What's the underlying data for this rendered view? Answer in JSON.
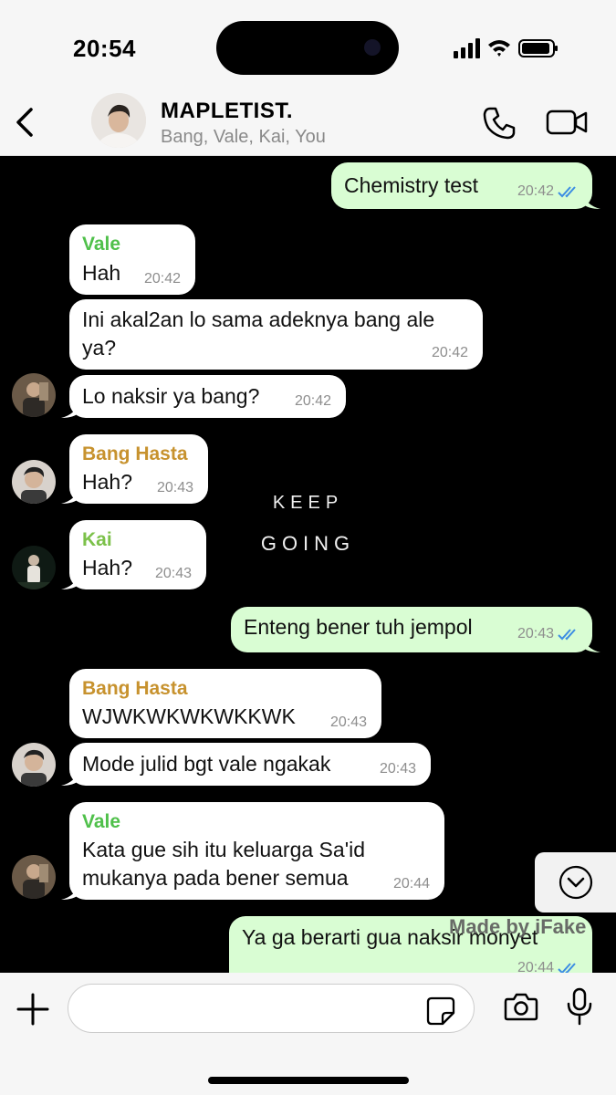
{
  "status": {
    "time": "20:54"
  },
  "header": {
    "title": "MAPLETIST.",
    "members": "Bang, Vale, Kai, You"
  },
  "wallpaper": {
    "line1": "KEEP",
    "line2": "GOING"
  },
  "colors": {
    "outgoing": "#d9fdd3",
    "incoming": "#ffffff",
    "vale": "#4fc04a",
    "bang_hasta": "#c7922e",
    "kai": "#7cc14a",
    "read_tick": "#3c8de3"
  },
  "messages": [
    {
      "dir": "out",
      "text": "Chemistry test",
      "time": "20:42",
      "read": true
    },
    {
      "dir": "in",
      "sender": "Vale",
      "text": "Hah",
      "time": "20:42"
    },
    {
      "dir": "in",
      "text": "Ini akal2an lo sama adeknya bang ale",
      "text2": "ya?",
      "time": "20:42"
    },
    {
      "dir": "in",
      "text": "Lo naksir ya bang?",
      "time": "20:42"
    },
    {
      "dir": "in",
      "sender": "Bang Hasta",
      "text": "Hah?",
      "time": "20:43"
    },
    {
      "dir": "in",
      "sender": "Kai",
      "text": "Hah?",
      "time": "20:43"
    },
    {
      "dir": "out",
      "text": "Enteng bener tuh jempol",
      "time": "20:43",
      "read": true
    },
    {
      "dir": "in",
      "sender": "Bang Hasta",
      "text": "WJWKWKWKWKKWK",
      "time": "20:43"
    },
    {
      "dir": "in",
      "text": "Mode julid bgt vale ngakak",
      "time": "20:43"
    },
    {
      "dir": "in",
      "sender": "Vale",
      "text": "Kata gue sih itu keluarga Sa'id",
      "text2": "mukanya pada bener semua",
      "time": "20:44"
    },
    {
      "dir": "out",
      "text": "Ya ga berarti gua naksir monyet",
      "time": "20:44",
      "read": true
    }
  ],
  "watermark": "Made by iFake",
  "composer": {
    "value": "",
    "placeholder": ""
  }
}
